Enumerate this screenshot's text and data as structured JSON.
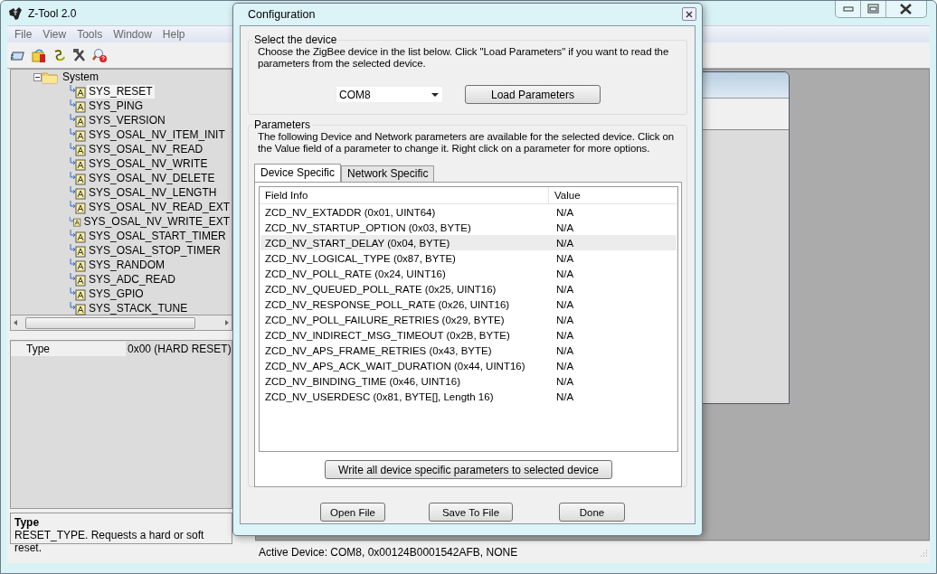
{
  "window": {
    "title": "Z-Tool 2.0"
  },
  "menu": [
    "File",
    "View",
    "Tools",
    "Window",
    "Help"
  ],
  "tree": [
    {
      "label": "System",
      "expanded": true,
      "children": [
        {
          "label": "SYS_RESET",
          "selected": true
        },
        {
          "label": "SYS_PING",
          "selected": false
        },
        {
          "label": "SYS_VERSION",
          "selected": false
        },
        {
          "label": "SYS_OSAL_NV_ITEM_INIT",
          "selected": false
        },
        {
          "label": "SYS_OSAL_NV_READ",
          "selected": false
        },
        {
          "label": "SYS_OSAL_NV_WRITE",
          "selected": false
        },
        {
          "label": "SYS_OSAL_NV_DELETE",
          "selected": false
        },
        {
          "label": "SYS_OSAL_NV_LENGTH",
          "selected": false
        },
        {
          "label": "SYS_OSAL_NV_READ_EXT",
          "selected": false
        },
        {
          "label": "SYS_OSAL_NV_WRITE_EXT",
          "selected": false
        },
        {
          "label": "SYS_OSAL_START_TIMER",
          "selected": false
        },
        {
          "label": "SYS_OSAL_STOP_TIMER",
          "selected": false
        },
        {
          "label": "SYS_RANDOM",
          "selected": false
        },
        {
          "label": "SYS_ADC_READ",
          "selected": false
        },
        {
          "label": "SYS_GPIO",
          "selected": false
        },
        {
          "label": "SYS_STACK_TUNE",
          "selected": false
        }
      ]
    }
  ],
  "properties": [
    {
      "name": "Type",
      "value": "0x00 (HARD RESET)"
    }
  ],
  "description": {
    "title": "Type",
    "text": "RESET_TYPE.  Requests a hard or soft reset."
  },
  "status_bar": "Active Device: COM8, 0x00124B0001542AFB, NONE",
  "dialog": {
    "title": "Configuration",
    "device_group": {
      "legend": "Select the device",
      "text": "Choose the ZigBee device in the list below.  Click \"Load Parameters\" if you want to read the parameters from the selected device.",
      "device": "COM8",
      "load_button": "Load Parameters"
    },
    "parameters_group": {
      "legend": "Parameters",
      "text": "The following Device and Network parameters are available for the selected device.  Click on the Value field of a parameter to change it.  Right click on a parameter for more options.",
      "tabs": [
        {
          "label": "Device Specific",
          "selected": true
        },
        {
          "label": "Network Specific",
          "selected": false
        }
      ],
      "columns": [
        "Field Info",
        "Value"
      ],
      "rows": [
        {
          "field": "ZCD_NV_EXTADDR (0x01, UINT64)",
          "value": "N/A",
          "selected": false
        },
        {
          "field": "ZCD_NV_STARTUP_OPTION (0x03, BYTE)",
          "value": "N/A",
          "selected": false
        },
        {
          "field": "ZCD_NV_START_DELAY (0x04, BYTE)",
          "value": "N/A",
          "selected": true
        },
        {
          "field": "ZCD_NV_LOGICAL_TYPE (0x87, BYTE)",
          "value": "N/A",
          "selected": false
        },
        {
          "field": "ZCD_NV_POLL_RATE (0x24, UINT16)",
          "value": "N/A",
          "selected": false
        },
        {
          "field": "ZCD_NV_QUEUED_POLL_RATE (0x25, UINT16)",
          "value": "N/A",
          "selected": false
        },
        {
          "field": "ZCD_NV_RESPONSE_POLL_RATE (0x26, UINT16)",
          "value": "N/A",
          "selected": false
        },
        {
          "field": "ZCD_NV_POLL_FAILURE_RETRIES (0x29, BYTE)",
          "value": "N/A",
          "selected": false
        },
        {
          "field": "ZCD_NV_INDIRECT_MSG_TIMEOUT (0x2B, BYTE)",
          "value": "N/A",
          "selected": false
        },
        {
          "field": "ZCD_NV_APS_FRAME_RETRIES (0x43, BYTE)",
          "value": "N/A",
          "selected": false
        },
        {
          "field": "ZCD_NV_APS_ACK_WAIT_DURATION (0x44, UINT16)",
          "value": "N/A",
          "selected": false
        },
        {
          "field": "ZCD_NV_BINDING_TIME (0x46, UINT16)",
          "value": "N/A",
          "selected": false
        },
        {
          "field": "ZCD_NV_USERDESC (0x81, BYTE[], Length 16)",
          "value": "N/A",
          "selected": false
        }
      ],
      "write_button": "Write all device specific parameters to selected device"
    },
    "buttons": [
      "Open File",
      "Save To File",
      "Done"
    ]
  }
}
